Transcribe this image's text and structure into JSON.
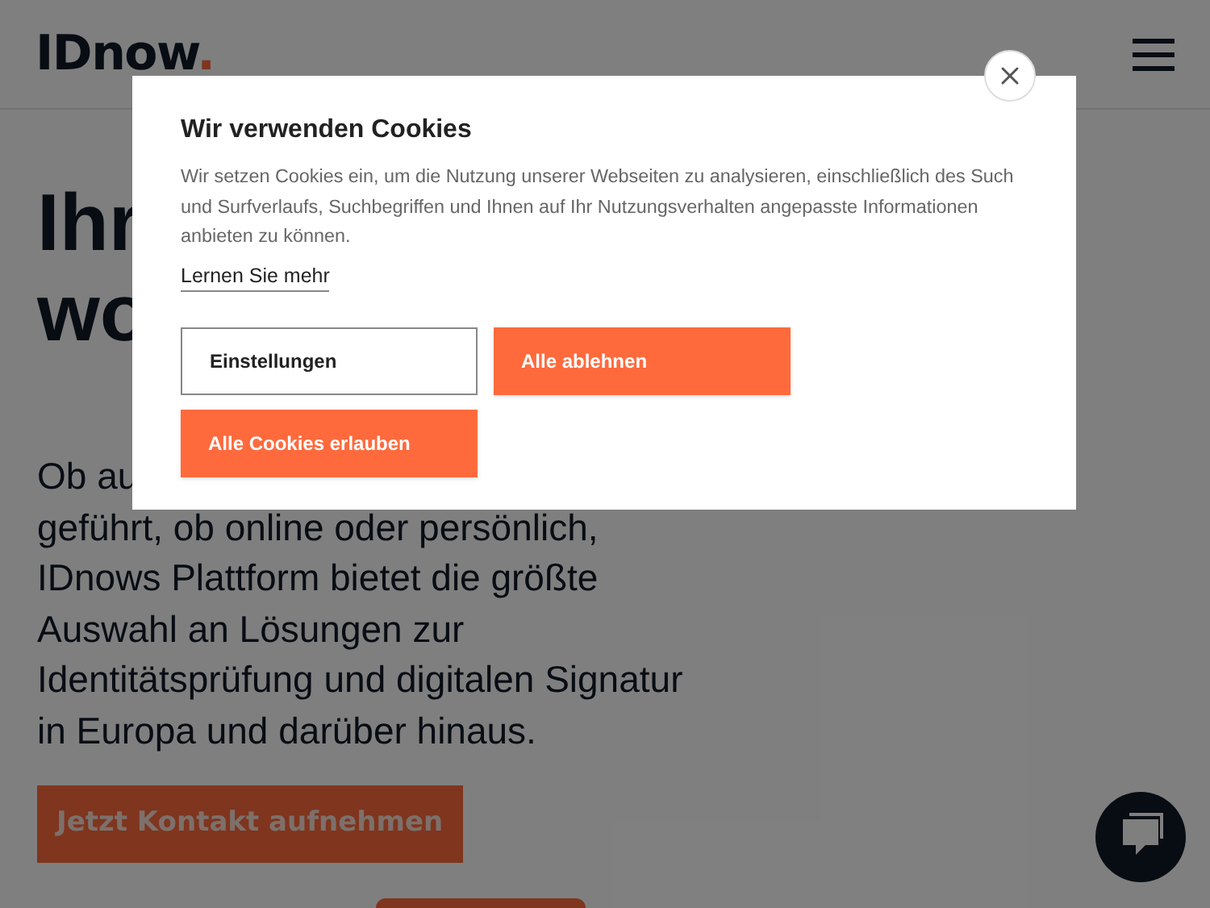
{
  "header": {
    "logo": "IDnow",
    "logo_dot": "."
  },
  "hero": {
    "headline_lines": [
      "Ihr",
      "wo"
    ],
    "paragraph_lines": [
      "Ob au",
      "geführt, ob online oder persönlich,",
      "IDnows Plattform bietet die größte",
      "Auswahl an Lösungen zur",
      "Identitätsprüfung und digitalen Signatur",
      "in Europa und darüber hinaus."
    ],
    "cta": "Jetzt Kontakt aufnehmen"
  },
  "cookie_dialog": {
    "title": "Wir verwenden Cookies",
    "body": "Wir setzen Cookies ein, um die Nutzung unserer Webseiten zu analysieren, einschließlich des Such und Surfverlaufs, Suchbegriffen und Ihnen auf Ihr Nutzungsverhalten angepasste Informationen anbieten zu können.",
    "link": "Lernen Sie mehr",
    "buttons": [
      {
        "label": "Einstellungen",
        "kind": "outline"
      },
      {
        "label": "Alle ablehnen",
        "kind": "filled"
      },
      {
        "label": "Alle Cookies erlauben",
        "kind": "filled"
      }
    ]
  }
}
